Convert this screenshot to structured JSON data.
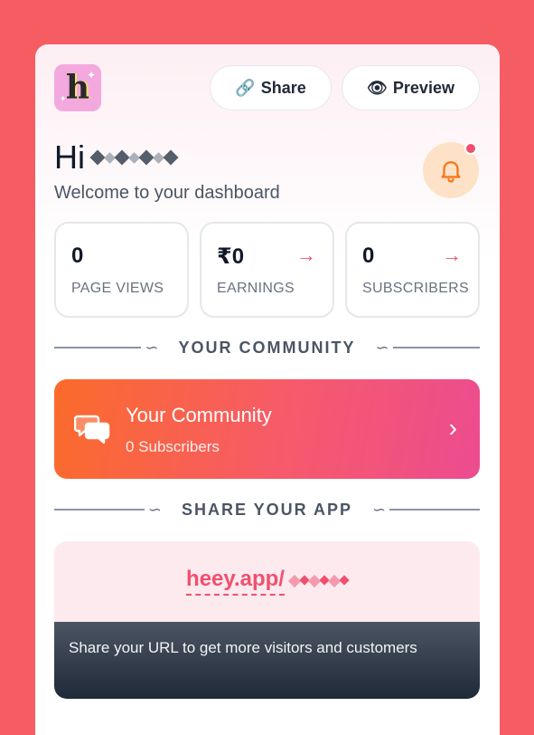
{
  "header": {
    "logo_letter": "h",
    "share_label": "Share",
    "preview_label": "Preview",
    "share_icon": "link-icon",
    "preview_icon": "eye-icon"
  },
  "greeting": {
    "hi": "Hi",
    "welcome": "Welcome to your dashboard"
  },
  "notification": {
    "icon": "bell-icon",
    "has_unread": true
  },
  "stats": [
    {
      "value": "0",
      "label": "PAGE VIEWS",
      "has_arrow": false
    },
    {
      "value": "₹0",
      "label": "EARNINGS",
      "has_arrow": true
    },
    {
      "value": "0",
      "label": "SUBSCRIBERS",
      "has_arrow": true
    }
  ],
  "community_section": {
    "heading": "YOUR COMMUNITY",
    "card_title": "Your Community",
    "card_subtitle": "0 Subscribers"
  },
  "share_section": {
    "heading": "SHARE YOUR APP",
    "url_prefix": "heey.app/",
    "note": "Share your URL to get more visitors and customers"
  },
  "colors": {
    "background": "#f55d62",
    "accent": "#f0506e",
    "gradient_start": "#fb6b2a",
    "gradient_end": "#ec4c8f"
  }
}
